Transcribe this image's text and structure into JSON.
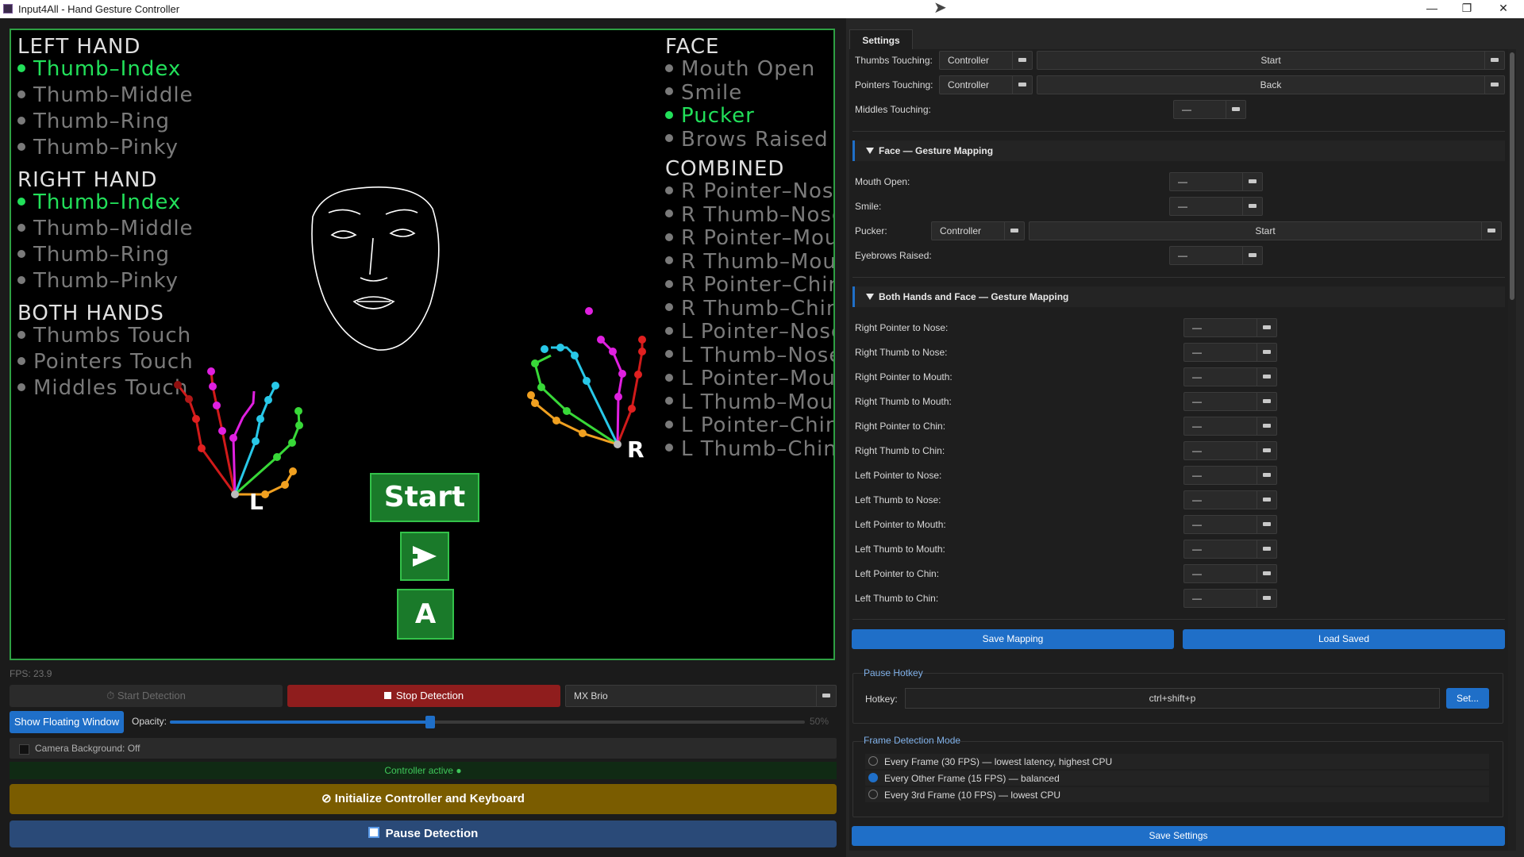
{
  "window": {
    "title": "Input4All - Hand Gesture Controller",
    "controls": {
      "minimize": "—",
      "maximize": "❐",
      "close": "✕"
    }
  },
  "video": {
    "left_hand": {
      "heading": "LEFT HAND",
      "items": [
        {
          "label": "Thumb–Index",
          "active": true
        },
        {
          "label": "Thumb–Middle",
          "active": false
        },
        {
          "label": "Thumb–Ring",
          "active": false
        },
        {
          "label": "Thumb–Pinky",
          "active": false
        }
      ]
    },
    "right_hand": {
      "heading": "RIGHT HAND",
      "items": [
        {
          "label": "Thumb–Index",
          "active": true
        },
        {
          "label": "Thumb–Middle",
          "active": false
        },
        {
          "label": "Thumb–Ring",
          "active": false
        },
        {
          "label": "Thumb–Pinky",
          "active": false
        }
      ]
    },
    "both_hands": {
      "heading": "BOTH HANDS",
      "items": [
        {
          "label": "Thumbs Touch",
          "active": false
        },
        {
          "label": "Pointers Touch",
          "active": false
        },
        {
          "label": "Middles Touch",
          "active": false
        }
      ]
    },
    "face": {
      "heading": "FACE",
      "items": [
        {
          "label": "Mouth Open",
          "active": false
        },
        {
          "label": "Smile",
          "active": false
        },
        {
          "label": "Pucker",
          "active": true
        },
        {
          "label": "Brows Raised",
          "active": false
        }
      ]
    },
    "combined": {
      "heading": "COMBINED",
      "items": [
        {
          "label": "R Pointer–Nose",
          "active": false
        },
        {
          "label": "R Thumb–Nose",
          "active": false
        },
        {
          "label": "R Pointer–Mouth",
          "active": false
        },
        {
          "label": "R Thumb–Mouth",
          "active": false
        },
        {
          "label": "R Pointer–Chin",
          "active": false
        },
        {
          "label": "R Thumb–Chin",
          "active": false
        },
        {
          "label": "L Pointer–Nose",
          "active": false
        },
        {
          "label": "L Thumb–Nose",
          "active": false
        },
        {
          "label": "L Pointer–Mouth",
          "active": false
        },
        {
          "label": "L Thumb–Mouth",
          "active": false
        },
        {
          "label": "L Pointer–Chin",
          "active": false
        },
        {
          "label": "L Thumb–Chin",
          "active": false
        }
      ]
    },
    "hand_labels": {
      "left": "L",
      "right": "R"
    },
    "overlay_buttons": {
      "start": "Start",
      "a": "A",
      "triangle_icon": "play-arrow-icon"
    },
    "colors": {
      "active": "#22e05a",
      "inactive": "#7a7a7a",
      "border": "#2ea043"
    }
  },
  "controls": {
    "fps": "FPS: 23.9",
    "start_detection": "Start Detection",
    "stop_detection": "Stop Detection",
    "camera": "MX Brio",
    "show_floating": "Show Floating Window",
    "opacity_label": "Opacity:",
    "opacity_value": "50%",
    "opacity_fraction": 0.5,
    "camera_background": "Camera Background: Off",
    "status": "Controller active ●",
    "init_button": "Initialize Controller and Keyboard",
    "pause_button": "Pause Detection"
  },
  "settings": {
    "tab": "Settings",
    "hands_rows": [
      {
        "label": "Thumbs Touching:",
        "device": "Controller",
        "action": "Start"
      },
      {
        "label": "Pointers Touching:",
        "device": "Controller",
        "action": "Back"
      },
      {
        "label": "Middles Touching:",
        "device": "",
        "action": "—"
      }
    ],
    "face_section": "Face — Gesture Mapping",
    "face_rows": [
      {
        "label": "Mouth Open:",
        "device": "",
        "action": "—"
      },
      {
        "label": "Smile:",
        "device": "",
        "action": "—"
      },
      {
        "label": "Pucker:",
        "device": "Controller",
        "action": "Start"
      },
      {
        "label": "Eyebrows Raised:",
        "device": "",
        "action": "—"
      }
    ],
    "combined_section": "Both Hands and Face — Gesture Mapping",
    "combined_rows": [
      {
        "label": "Right Pointer to Nose:",
        "action": "—"
      },
      {
        "label": "Right Thumb to Nose:",
        "action": "—"
      },
      {
        "label": "Right Pointer to Mouth:",
        "action": "—"
      },
      {
        "label": "Right Thumb to Mouth:",
        "action": "—"
      },
      {
        "label": "Right Pointer to Chin:",
        "action": "—"
      },
      {
        "label": "Right Thumb to Chin:",
        "action": "—"
      },
      {
        "label": "Left Pointer to Nose:",
        "action": "—"
      },
      {
        "label": "Left Thumb to Nose:",
        "action": "—"
      },
      {
        "label": "Left Pointer to Mouth:",
        "action": "—"
      },
      {
        "label": "Left Thumb to Mouth:",
        "action": "—"
      },
      {
        "label": "Left Pointer to Chin:",
        "action": "—"
      },
      {
        "label": "Left Thumb to Chin:",
        "action": "—"
      }
    ],
    "save_mapping": "Save Mapping",
    "load_saved": "Load Saved",
    "pause_hotkey_title": "Pause Hotkey",
    "hotkey_label": "Hotkey:",
    "hotkey_value": "ctrl+shift+p",
    "hotkey_set": "Set...",
    "frame_mode_title": "Frame Detection Mode",
    "frame_modes": [
      {
        "label": "Every Frame (30 FPS) — lowest latency, highest CPU",
        "selected": false
      },
      {
        "label": "Every Other Frame (15 FPS) — balanced",
        "selected": true
      },
      {
        "label": "Every 3rd Frame (10 FPS) — lowest CPU",
        "selected": false
      }
    ],
    "save_settings": "Save Settings",
    "accent": "#1f6fc8"
  }
}
